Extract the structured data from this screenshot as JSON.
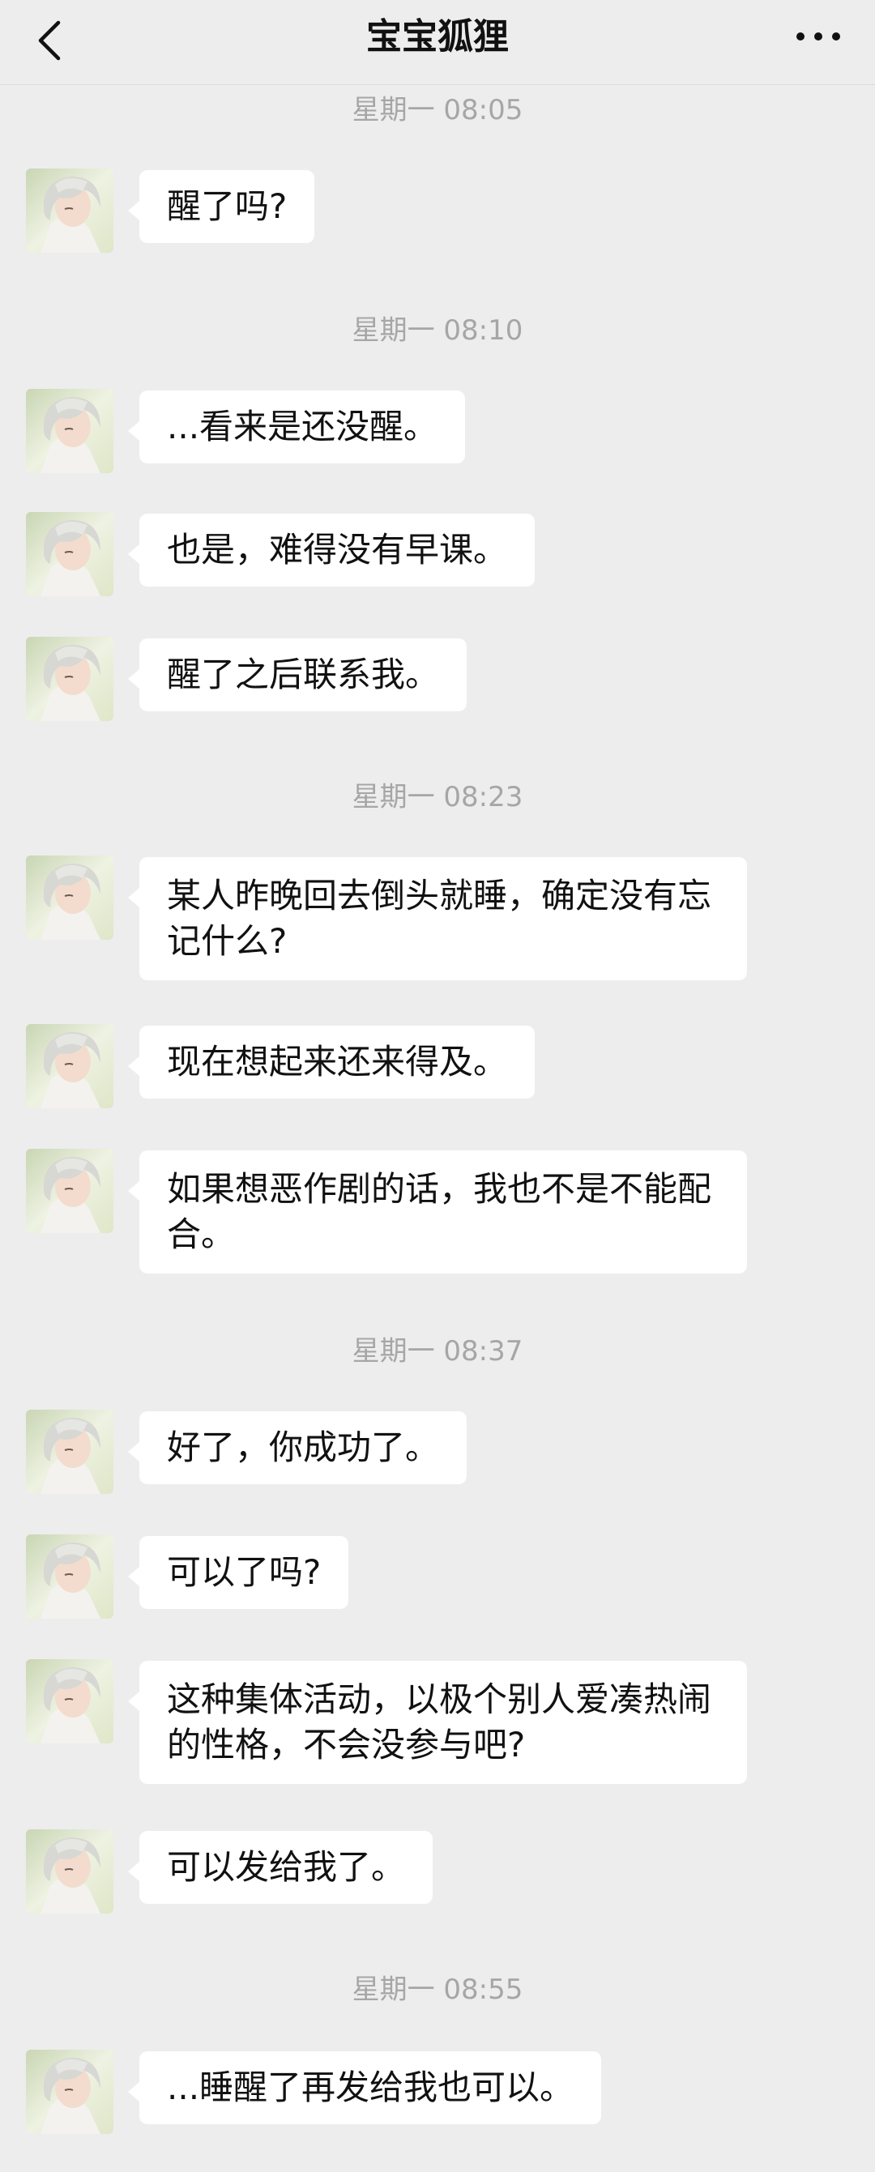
{
  "header": {
    "title": "宝宝狐狸"
  },
  "icons": {
    "back": "chevron-left-icon",
    "more": "more-horizontal-icon"
  },
  "timestamps": [
    "星期一 08:05",
    "星期一 08:10",
    "星期一 08:23",
    "星期一 08:37",
    "星期一 08:55"
  ],
  "messages": [
    "醒了吗?",
    "...看来是还没醒。",
    "也是，难得没有早课。",
    "醒了之后联系我。",
    "某人昨晚回去倒头就睡，确定没有忘记什么?",
    "现在想起来还来得及。",
    "如果想恶作剧的话，我也不是不能配合。",
    "好了，你成功了。",
    "可以了吗?",
    "这种集体活动，以极个别人爱凑热闹的性格，不会没参与吧?",
    "可以发给我了。",
    "...睡醒了再发给我也可以。"
  ],
  "colors": {
    "background": "#ededed",
    "bubble": "#ffffff",
    "timestamp": "#a6a6a6"
  }
}
